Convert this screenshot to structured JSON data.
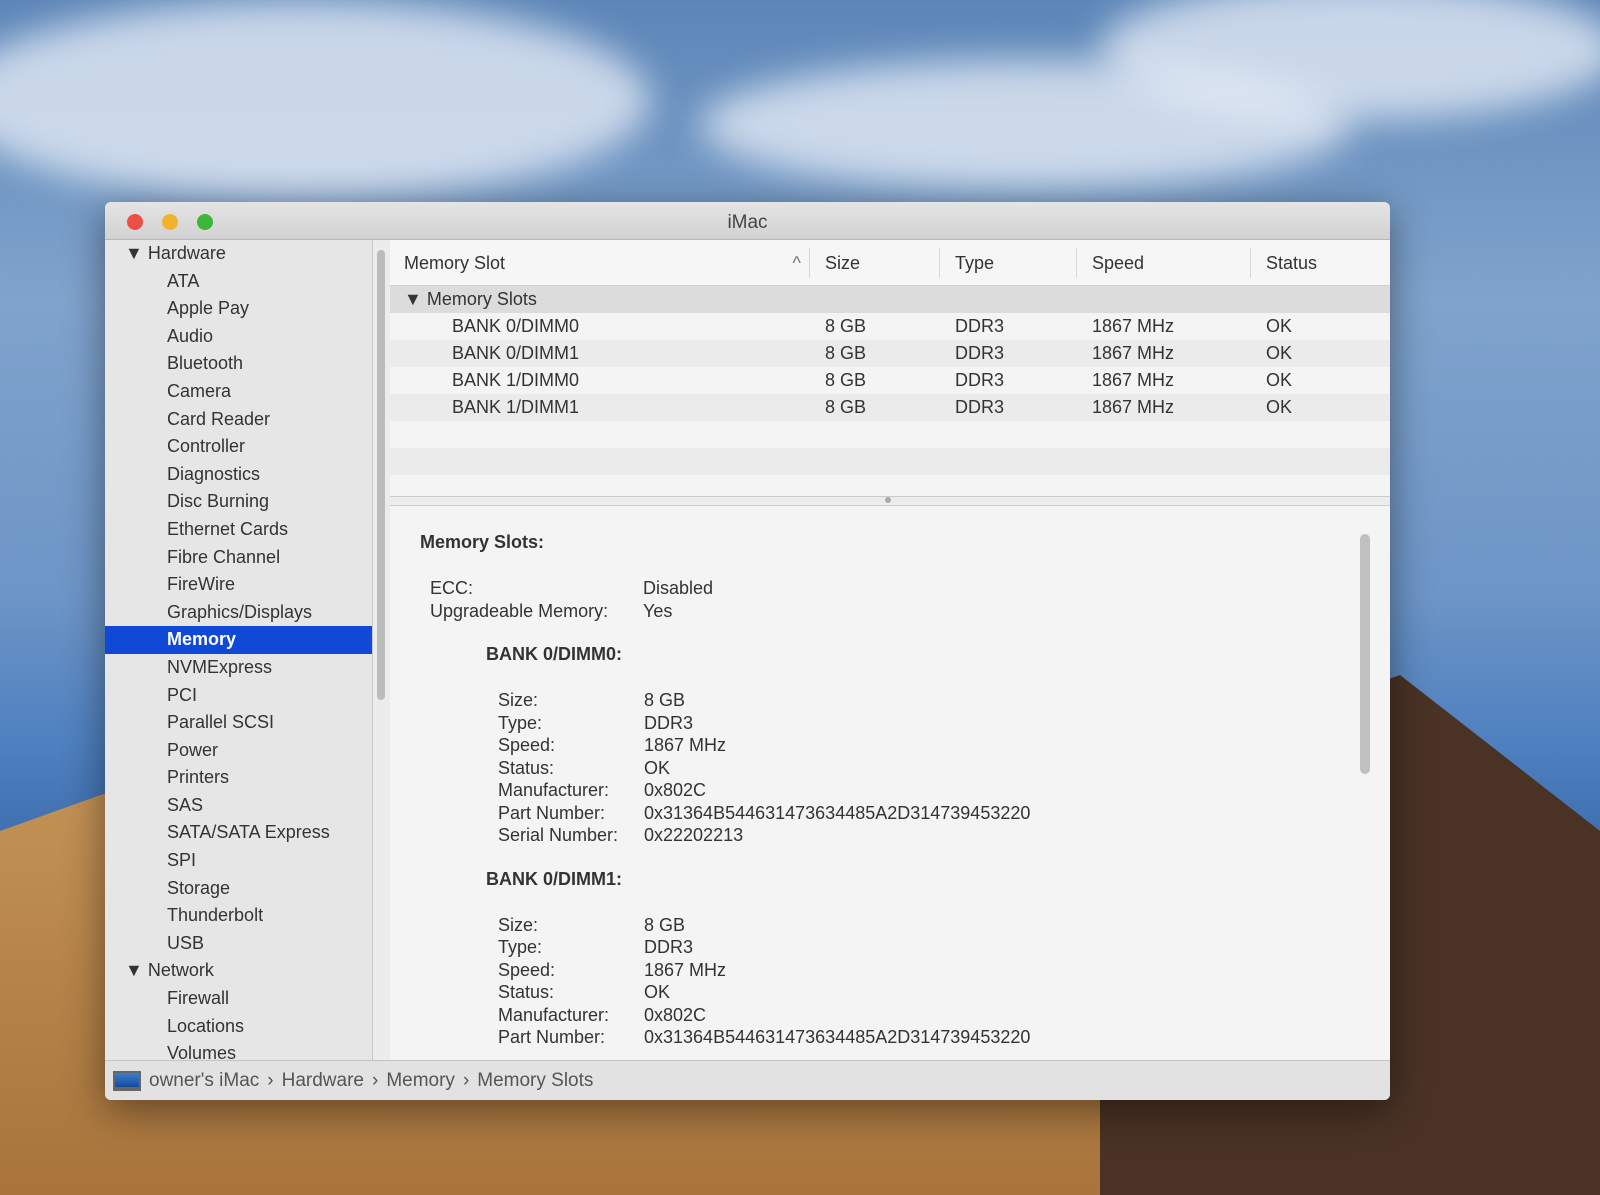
{
  "window": {
    "title": "iMac"
  },
  "sidebar": {
    "hardware": "Hardware",
    "hardware_items": [
      "ATA",
      "Apple Pay",
      "Audio",
      "Bluetooth",
      "Camera",
      "Card Reader",
      "Controller",
      "Diagnostics",
      "Disc Burning",
      "Ethernet Cards",
      "Fibre Channel",
      "FireWire",
      "Graphics/Displays",
      "Memory",
      "NVMExpress",
      "PCI",
      "Parallel SCSI",
      "Power",
      "Printers",
      "SAS",
      "SATA/SATA Express",
      "SPI",
      "Storage",
      "Thunderbolt",
      "USB"
    ],
    "network": "Network",
    "network_items": [
      "Firewall",
      "Locations",
      "Volumes"
    ],
    "selected": "Memory"
  },
  "table": {
    "headers": [
      "Memory Slot",
      "Size",
      "Type",
      "Speed",
      "Status"
    ],
    "group": "Memory Slots",
    "rows": [
      [
        "BANK 0/DIMM0",
        "8 GB",
        "DDR3",
        "1867 MHz",
        "OK"
      ],
      [
        "BANK 0/DIMM1",
        "8 GB",
        "DDR3",
        "1867 MHz",
        "OK"
      ],
      [
        "BANK 1/DIMM0",
        "8 GB",
        "DDR3",
        "1867 MHz",
        "OK"
      ],
      [
        "BANK 1/DIMM1",
        "8 GB",
        "DDR3",
        "1867 MHz",
        "OK"
      ]
    ]
  },
  "details": {
    "heading": "Memory Slots:",
    "general": [
      [
        "ECC:",
        "Disabled"
      ],
      [
        "Upgradeable Memory:",
        "Yes"
      ]
    ],
    "banks": [
      {
        "name": "BANK 0/DIMM0:",
        "fields": [
          [
            "Size:",
            "8 GB"
          ],
          [
            "Type:",
            "DDR3"
          ],
          [
            "Speed:",
            "1867 MHz"
          ],
          [
            "Status:",
            "OK"
          ],
          [
            "Manufacturer:",
            "0x802C"
          ],
          [
            "Part Number:",
            "0x31364B544631473634485A2D314739453220"
          ],
          [
            "Serial Number:",
            "0x22202213"
          ]
        ]
      },
      {
        "name": "BANK 0/DIMM1:",
        "fields": [
          [
            "Size:",
            "8 GB"
          ],
          [
            "Type:",
            "DDR3"
          ],
          [
            "Speed:",
            "1867 MHz"
          ],
          [
            "Status:",
            "OK"
          ],
          [
            "Manufacturer:",
            "0x802C"
          ],
          [
            "Part Number:",
            "0x31364B544631473634485A2D314739453220"
          ]
        ]
      }
    ]
  },
  "statusbar": {
    "path": [
      "owner's iMac",
      "Hardware",
      "Memory",
      "Memory Slots"
    ],
    "separator": "›"
  }
}
